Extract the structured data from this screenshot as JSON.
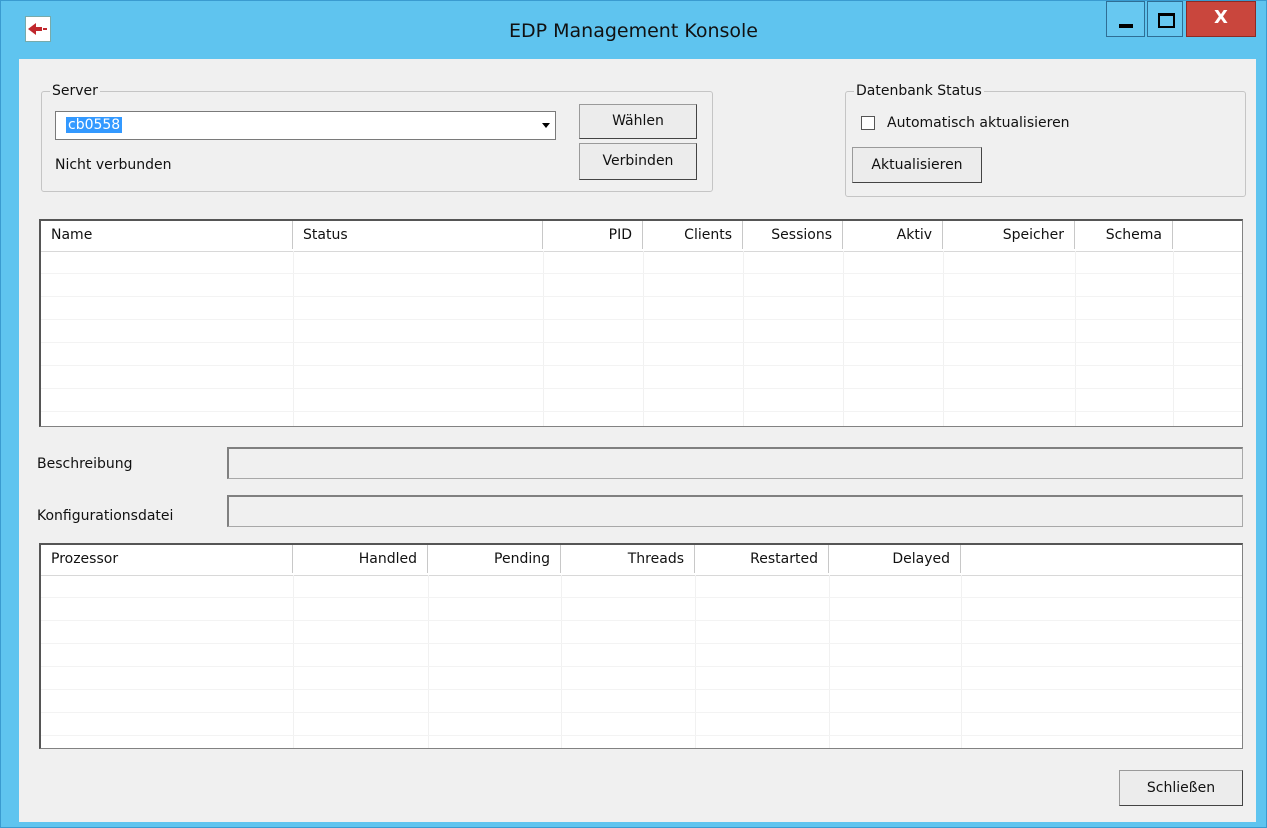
{
  "window": {
    "title": "EDP Management Konsole",
    "close_glyph": "X",
    "icon": "app-logo-icon"
  },
  "server_group": {
    "legend": "Server",
    "combo_value": "cb0558",
    "waehlen_label": "Wählen",
    "verbinden_label": "Verbinden",
    "status": "Nicht verbunden"
  },
  "db_group": {
    "legend": "Datenbank Status",
    "auto_update_label": "Automatisch aktualisieren",
    "auto_update_checked": false,
    "aktualisieren_label": "Aktualisieren"
  },
  "db_table": {
    "columns": [
      "Name",
      "Status",
      "PID",
      "Clients",
      "Sessions",
      "Aktiv",
      "Speicher",
      "Schema"
    ],
    "rows": []
  },
  "fields": {
    "beschreibung_label": "Beschreibung",
    "beschreibung_value": "",
    "konfig_label": "Konfigurationsdatei",
    "konfig_value": ""
  },
  "proc_table": {
    "columns": [
      "Prozessor",
      "Handled",
      "Pending",
      "Threads",
      "Restarted",
      "Delayed"
    ],
    "rows": []
  },
  "footer": {
    "schliessen_label": "Schließen"
  }
}
